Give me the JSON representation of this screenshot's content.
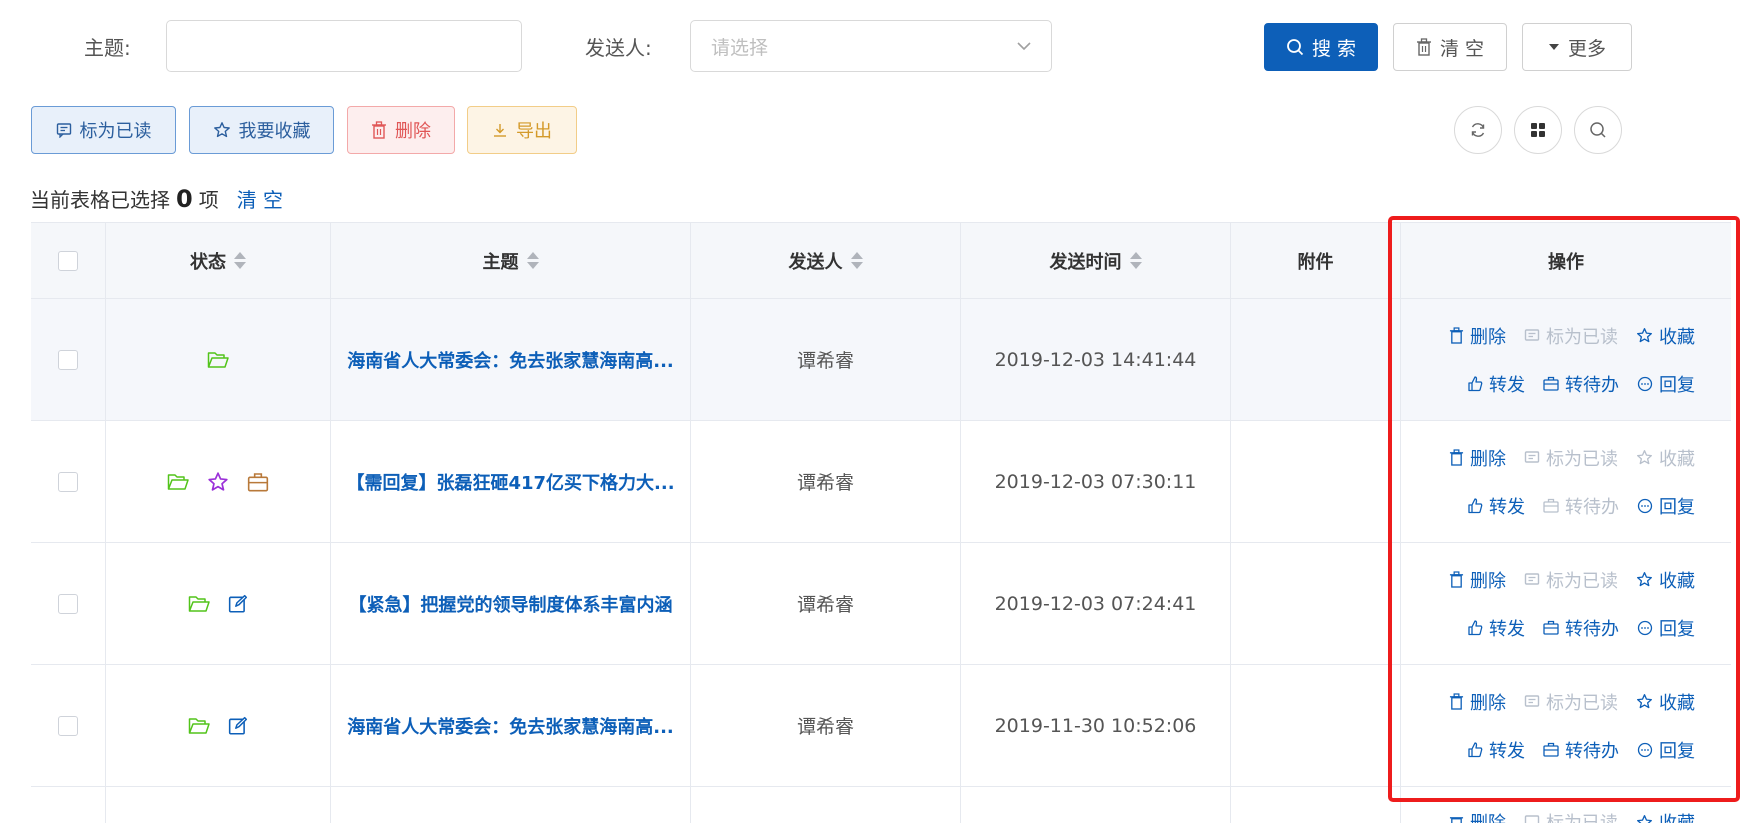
{
  "search": {
    "subject_label": "主题:",
    "subject_value": "",
    "sender_label": "发送人:",
    "sender_placeholder": "请选择",
    "search_button": "搜 索",
    "clear_button": "清 空",
    "more_button": "更多"
  },
  "toolbar": {
    "mark_read": "标为已读",
    "favorite": "我要收藏",
    "delete": "删除",
    "export": "导出"
  },
  "selection": {
    "prefix": "当前表格已选择",
    "count": "0",
    "suffix": "项",
    "clear": "清 空"
  },
  "table": {
    "headers": {
      "status": "状态",
      "subject": "主题",
      "sender": "发送人",
      "time": "发送时间",
      "attachment": "附件",
      "ops": "操作"
    },
    "ops_labels": {
      "delete": "删除",
      "mark_read": "标为已读",
      "favorite": "收藏",
      "forward": "转发",
      "todo": "转待办",
      "reply": "回复"
    },
    "rows": [
      {
        "subject": "海南省人大常委会：免去张家慧海南高...",
        "sender": "谭希睿",
        "time": "2019-12-03 14:41:44"
      },
      {
        "subject": "【需回复】张磊狂砸417亿买下格力大...",
        "sender": "谭希睿",
        "time": "2019-12-03 07:30:11"
      },
      {
        "subject": "【紧急】把握党的领导制度体系丰富内涵",
        "sender": "谭希睿",
        "time": "2019-12-03 07:24:41"
      },
      {
        "subject": "海南省人大常委会：免去张家慧海南高...",
        "sender": "谭希睿",
        "time": "2019-11-30 10:52:06"
      }
    ],
    "partial_row_ops": {
      "delete": "删除",
      "mark_read": "标为已读",
      "favorite": "收藏"
    }
  },
  "colors": {
    "primary": "#0d5fb8",
    "highlight": "#ee1c1c",
    "folder": "#52c41a",
    "star": "#9b30d9",
    "briefcase": "#b8793a"
  }
}
